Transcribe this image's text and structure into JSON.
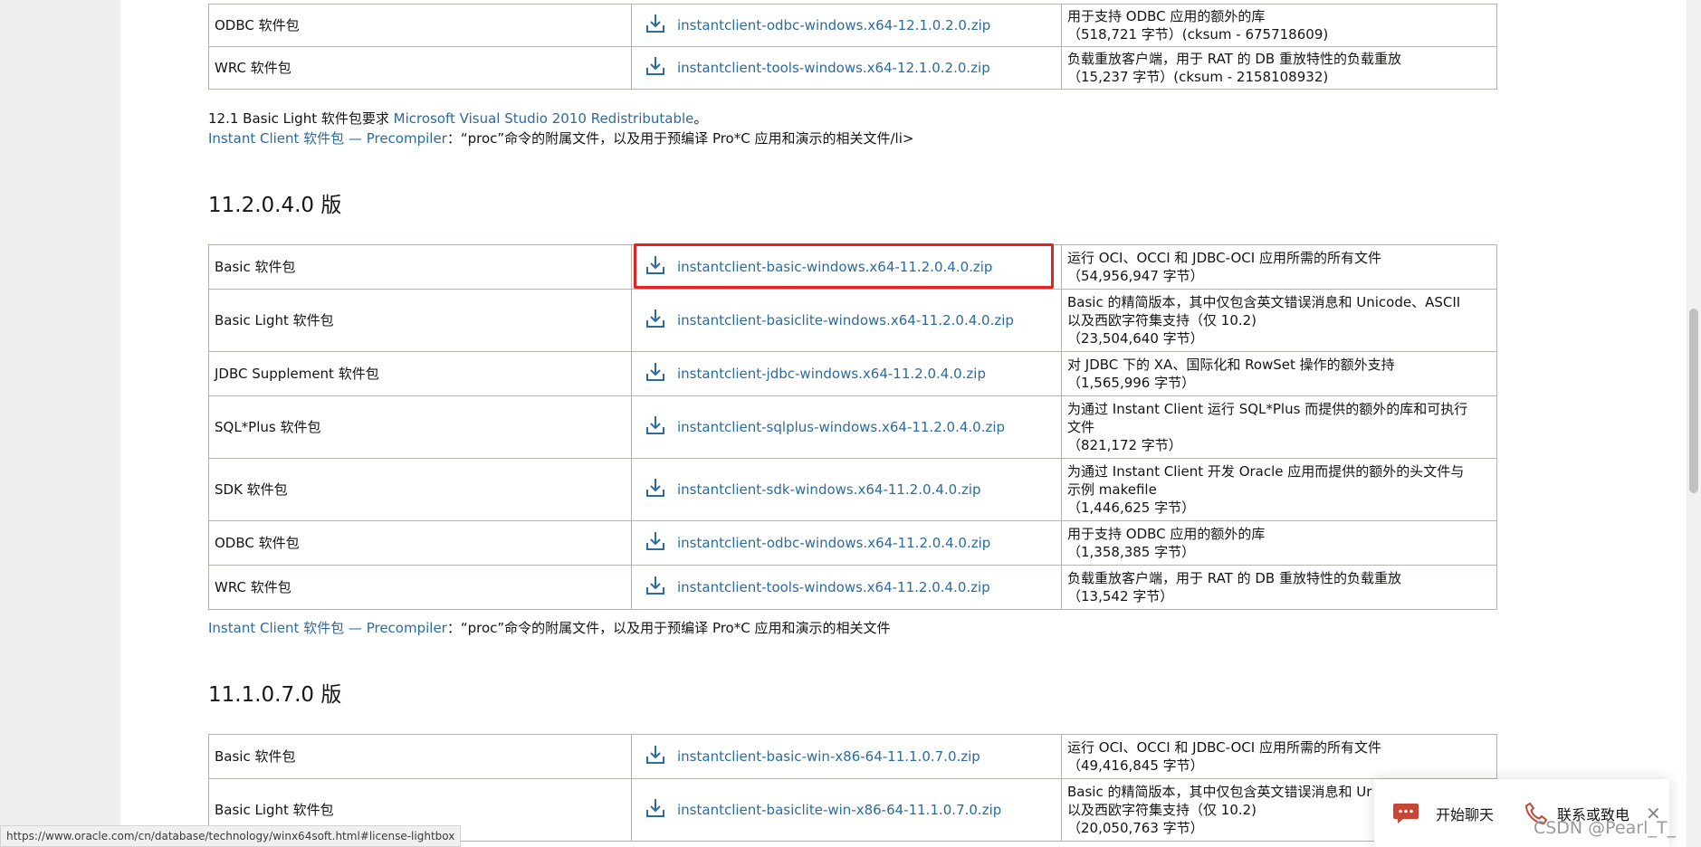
{
  "top_table": [
    {
      "name": "ODBC 软件包",
      "file": "instantclient-odbc-windows.x64-12.1.0.2.0.zip",
      "desc1": "用于支持 ODBC 应用的额外的库",
      "desc2": "（518,721 字节）(cksum - 675718609)"
    },
    {
      "name": "WRC 软件包",
      "file": "instantclient-tools-windows.x64-12.1.0.2.0.zip",
      "desc1": "负载重放客户端，用于 RAT 的 DB 重放特性的负载重放",
      "desc2": "（15,237 字节）(cksum - 2158108932)"
    }
  ],
  "notes_12": {
    "line1_prefix": "12.1 Basic Light 软件包要求 ",
    "line1_link": "Microsoft Visual Studio 2010 Redistributable",
    "line1_suffix": "。",
    "line2_link": "Instant Client 软件包 — Precompiler",
    "line2_suffix": "：“proc”命令的附属文件，以及用于预编译 Pro*C 应用和演示的相关文件/li>"
  },
  "section_11204": {
    "heading": "11.2.0.4.0 版",
    "rows": [
      {
        "name": "Basic 软件包",
        "file": "instantclient-basic-windows.x64-11.2.0.4.0.zip",
        "desc": [
          "运行 OCI、OCCI 和 JDBC-OCI 应用所需的所有文件",
          "（54,956,947 字节）"
        ],
        "highlighted": true
      },
      {
        "name": "Basic Light 软件包",
        "file": "instantclient-basiclite-windows.x64-11.2.0.4.0.zip",
        "desc": [
          "Basic 的精简版本，其中仅包含英文错误消息和 Unicode、ASCII",
          "以及西欧字符集支持（仅 10.2)",
          "（23,504,640 字节）"
        ]
      },
      {
        "name": "JDBC Supplement 软件包",
        "file": "instantclient-jdbc-windows.x64-11.2.0.4.0.zip",
        "desc": [
          "对 JDBC 下的 XA、国际化和 RowSet 操作的额外支持",
          "（1,565,996 字节）"
        ]
      },
      {
        "name": "SQL*Plus 软件包",
        "file": "instantclient-sqlplus-windows.x64-11.2.0.4.0.zip",
        "desc": [
          "为通过 Instant Client 运行 SQL*Plus 而提供的额外的库和可执行",
          "文件",
          "（821,172 字节）"
        ]
      },
      {
        "name": "SDK 软件包",
        "file": "instantclient-sdk-windows.x64-11.2.0.4.0.zip",
        "desc": [
          "为通过 Instant Client 开发 Oracle 应用而提供的额外的头文件与",
          "示例 makefile",
          "（1,446,625 字节）"
        ]
      },
      {
        "name": "ODBC 软件包",
        "file": "instantclient-odbc-windows.x64-11.2.0.4.0.zip",
        "desc": [
          "用于支持 ODBC 应用的额外的库",
          "（1,358,385 字节）"
        ]
      },
      {
        "name": "WRC 软件包",
        "file": "instantclient-tools-windows.x64-11.2.0.4.0.zip",
        "desc": [
          "负载重放客户端，用于 RAT 的 DB 重放特性的负载重放",
          "（13,542 字节）"
        ]
      }
    ],
    "note_link": "Instant Client 软件包 — Precompiler",
    "note_suffix": "：“proc”命令的附属文件，以及用于预编译 Pro*C 应用和演示的相关文件"
  },
  "section_11107": {
    "heading": "11.1.0.7.0 版",
    "rows": [
      {
        "name": "Basic 软件包",
        "file": "instantclient-basic-win-x86-64-11.1.0.7.0.zip",
        "desc": [
          "运行 OCI、OCCI 和 JDBC-OCI 应用所需的所有文件",
          "（49,416,845 字节）"
        ]
      },
      {
        "name": "Basic Light 软件包",
        "file": "instantclient-basiclite-win-x86-64-11.1.0.7.0.zip",
        "desc": [
          "Basic 的精简版本，其中仅包含英文错误消息和 Ur",
          "以及西欧字符集支持（仅 10.2)",
          "（20,050,763 字节）"
        ]
      }
    ]
  },
  "status_url": "https://www.oracle.com/cn/database/technology/winx64soft.html#license-lightbox",
  "chat_widget": {
    "chat_label": "开始聊天",
    "call_label": "联系或致电"
  },
  "watermark": "CSDN @Pearl_T_",
  "colors": {
    "link": "#2c6b9e",
    "highlight_border": "#e52222",
    "chat_red": "#c74634"
  }
}
